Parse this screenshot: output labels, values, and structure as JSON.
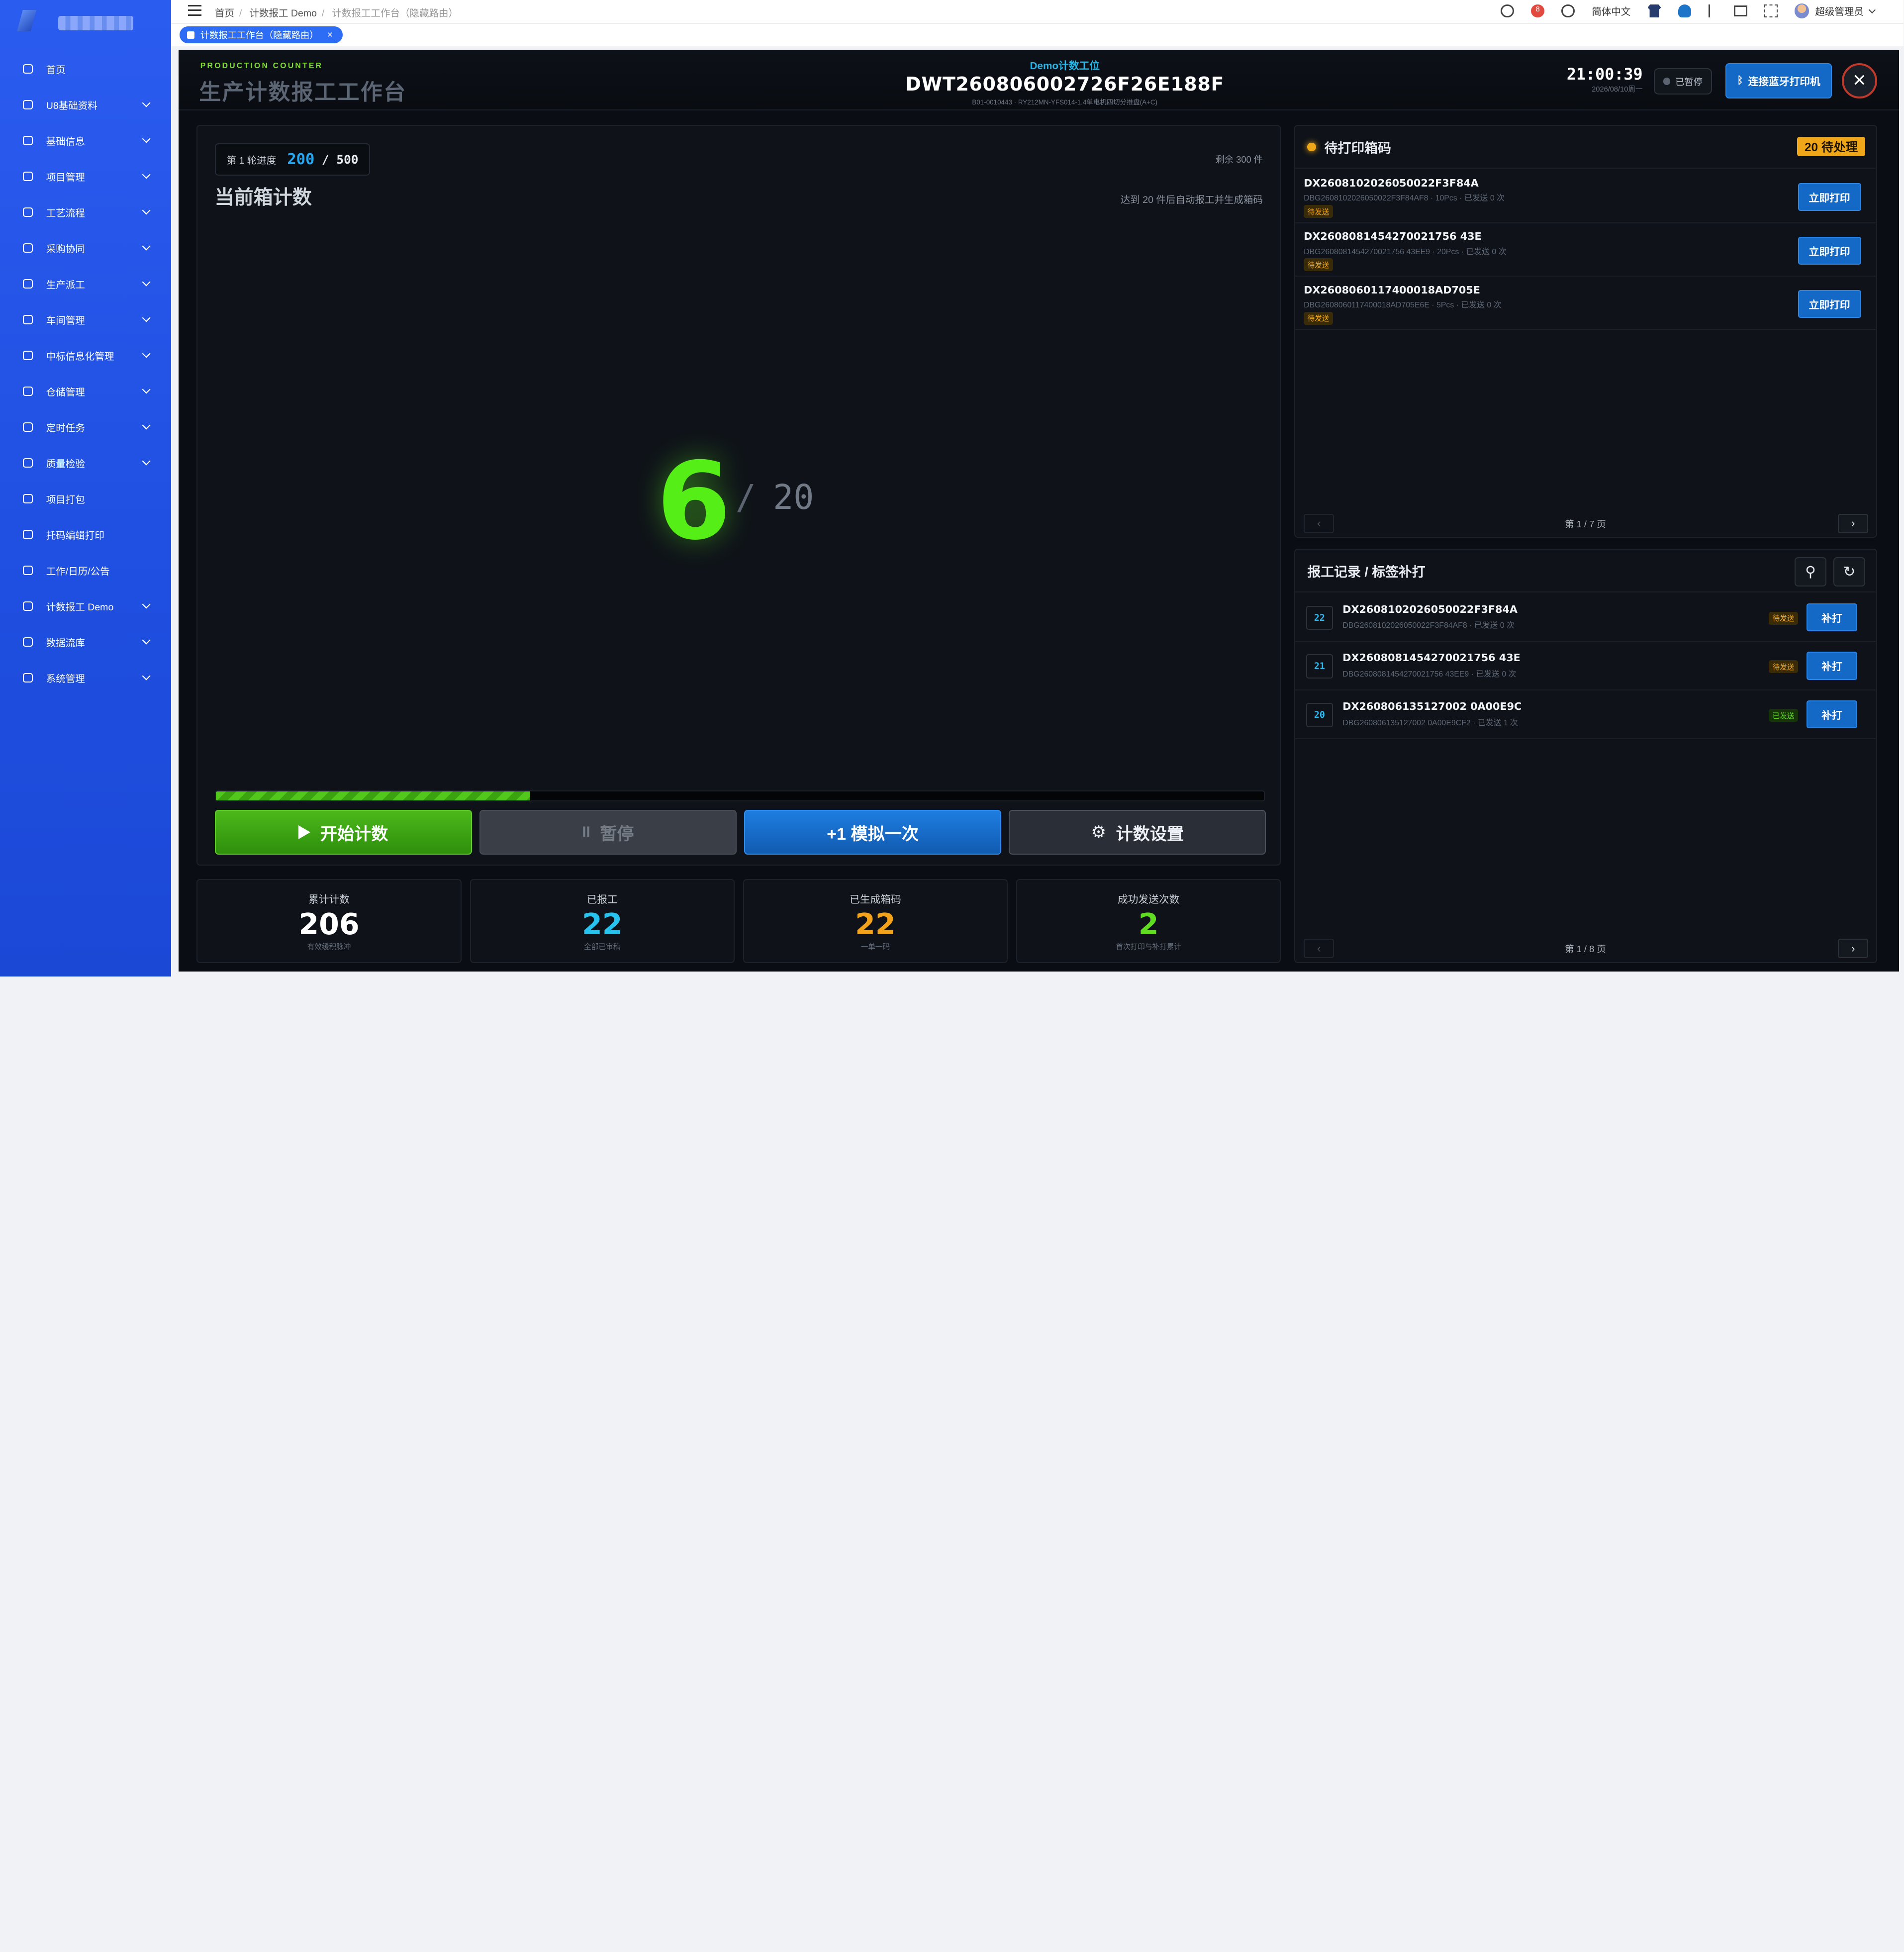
{
  "topbar": {
    "breadcrumbs": [
      "首页",
      "计数报工 Demo",
      "计数报工工作台（隐藏路由）"
    ],
    "lang": "简体中文",
    "user": "超级管理员",
    "notif_count": "8"
  },
  "tab": {
    "label": "计数报工工作台（隐藏路由）"
  },
  "sidebar": {
    "items": [
      {
        "label": "首页",
        "icon": "home-icon",
        "chev": false
      },
      {
        "label": "U8基础资料",
        "icon": "clipboard-icon",
        "chev": true
      },
      {
        "label": "基础信息",
        "icon": "bookmark-icon",
        "chev": true
      },
      {
        "label": "项目管理",
        "icon": "list-icon",
        "chev": true
      },
      {
        "label": "工艺流程",
        "icon": "clipboard-icon",
        "chev": true
      },
      {
        "label": "采购协同",
        "icon": "clipboard-icon",
        "chev": true
      },
      {
        "label": "生产派工",
        "icon": "dispatch-icon",
        "chev": true
      },
      {
        "label": "车间管理",
        "icon": "briefcase-icon",
        "chev": true
      },
      {
        "label": "中标信息化管理",
        "icon": "trophy-icon",
        "chev": true
      },
      {
        "label": "仓储管理",
        "icon": "lock-icon",
        "chev": true
      },
      {
        "label": "定时任务",
        "icon": "clipboard-icon",
        "chev": true
      },
      {
        "label": "质量检验",
        "icon": "clipboard-icon",
        "chev": true
      },
      {
        "label": "项目打包",
        "icon": "clipboard-icon",
        "chev": false
      },
      {
        "label": "托码编辑打印",
        "icon": "clipboard-icon",
        "chev": false
      },
      {
        "label": "工作/日历/公告",
        "icon": "clipboard-icon",
        "chev": false
      },
      {
        "label": "计数报工 Demo",
        "icon": "clipboard-icon",
        "chev": true
      },
      {
        "label": "数据流库",
        "icon": "document-icon",
        "chev": true
      },
      {
        "label": "系统管理",
        "icon": "gear-icon",
        "chev": true
      }
    ]
  },
  "header": {
    "brand_en": "PRODUCTION COUNTER",
    "brand_cn": "生产计数报工工作台",
    "station": "Demo计数工位",
    "order_code": "DWT260806002726F26E188F",
    "order_sub": "B01-0010443 · RY212MN-YFS014-1.4单电机四切分推盘(A+C)",
    "time": "21:00:39",
    "date": "2026/08/10周一",
    "pause_status": "已暂停",
    "connect_label": "连接蓝牙打印机",
    "close_label": "✕"
  },
  "counter": {
    "round_label": "第 1 轮进度",
    "round_current": "200",
    "round_total": "/ 500",
    "remaining": "剩余 300 件",
    "title": "当前箱计数",
    "auto_note": "达到 20 件后自动报工并生成箱码",
    "count": "6",
    "target": "20",
    "progress": 0.3,
    "buttons": {
      "start": "开始计数",
      "pause": "暂停",
      "sim": "+1 模拟一次",
      "settings": "计数设置"
    }
  },
  "stats": [
    {
      "label": "累计计数",
      "value": "206",
      "hint": "有效缓积脉冲",
      "color": "#ffffff"
    },
    {
      "label": "已报工",
      "value": "22",
      "hint": "全部已审稿",
      "color": "#27c2ee"
    },
    {
      "label": "已生成箱码",
      "value": "22",
      "hint": "一单一码",
      "color": "#f2a31b"
    },
    {
      "label": "成功发送次数",
      "value": "2",
      "hint": "首次打印与补打累计",
      "color": "#5fdc1f"
    }
  ],
  "queue": {
    "title": "待打印箱码",
    "badge": "20 待处理",
    "print_label": "立即打印",
    "tag": "待发送",
    "items": [
      {
        "code": "DX2608102026050022F3F84A",
        "detail": "DBG2608102026050022F3F84AF8 · 10Pcs · 已发送 0 次"
      },
      {
        "code": "DX2608081454270021756 43E",
        "detail": "DBG2608081454270021756 43EE9 · 20Pcs · 已发送 0 次"
      },
      {
        "code": "DX2608060117400018AD705E",
        "detail": "DBG2608060117400018AD705E6E · 5Pcs · 已发送 0 次"
      }
    ],
    "pager": "第 1 / 7 页"
  },
  "records": {
    "title": "报工记录 / 标签补打",
    "reprint_label": "补打",
    "items": [
      {
        "no": "22",
        "code": "DX2608102026050022F3F84A",
        "detail": "DBG2608102026050022F3F84AF8 · 已发送 0 次",
        "status": "待发送",
        "sent": false
      },
      {
        "no": "21",
        "code": "DX2608081454270021756 43E",
        "detail": "DBG2608081454270021756 43EE9 · 已发送 0 次",
        "status": "待发送",
        "sent": false
      },
      {
        "no": "20",
        "code": "DX260806135127002 0A00E9C",
        "detail": "DBG260806135127002 0A00E9CF2 · 已发送 1 次",
        "status": "已发送",
        "sent": true
      }
    ],
    "pager": "第 1 / 8 页"
  }
}
